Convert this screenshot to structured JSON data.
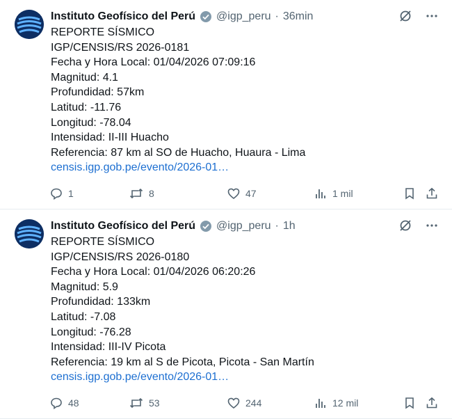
{
  "tweets": [
    {
      "author": "Instituto Geofísico del Perú",
      "handle": "@igp_peru",
      "time": "36min",
      "lines": [
        "REPORTE SÍSMICO",
        "IGP/CENSIS/RS 2026-0181",
        "Fecha y Hora Local: 01/04/2026 07:09:16",
        "Magnitud: 4.1",
        "Profundidad: 57km",
        "Latitud: -11.76",
        "Longitud: -78.04",
        "Intensidad: II-III Huacho",
        "Referencia: 87 km al SO de Huacho, Huaura - Lima"
      ],
      "link": "censis.igp.gob.pe/evento/2026-01…",
      "replies": "1",
      "retweets": "8",
      "likes": "47",
      "views": "1 mil"
    },
    {
      "author": "Instituto Geofísico del Perú",
      "handle": "@igp_peru",
      "time": "1h",
      "lines": [
        "REPORTE SÍSMICO",
        "IGP/CENSIS/RS 2026-0180",
        "Fecha y Hora Local: 01/04/2026 06:20:26",
        "Magnitud: 5.9",
        "Profundidad: 133km",
        "Latitud: -7.08",
        "Longitud: -76.28",
        "Intensidad: III-IV Picota",
        "Referencia: 19 km al S de Picota, Picota - San Martín"
      ],
      "link": "censis.igp.gob.pe/evento/2026-01…",
      "replies": "48",
      "retweets": "53",
      "likes": "244",
      "views": "12 mil"
    }
  ],
  "icons": {
    "avatar": "igp-logo-icon",
    "verified": "verified-badge-icon",
    "grok": "grok-icon",
    "more": "more-icon",
    "reply": "reply-icon",
    "retweet": "retweet-icon",
    "like": "heart-icon",
    "views": "views-icon",
    "bookmark": "bookmark-icon",
    "share": "share-icon"
  },
  "colors": {
    "link": "#1d6fd1",
    "muted": "#536471",
    "text": "#0f1419",
    "avatar_bg": "#0d2e63"
  }
}
